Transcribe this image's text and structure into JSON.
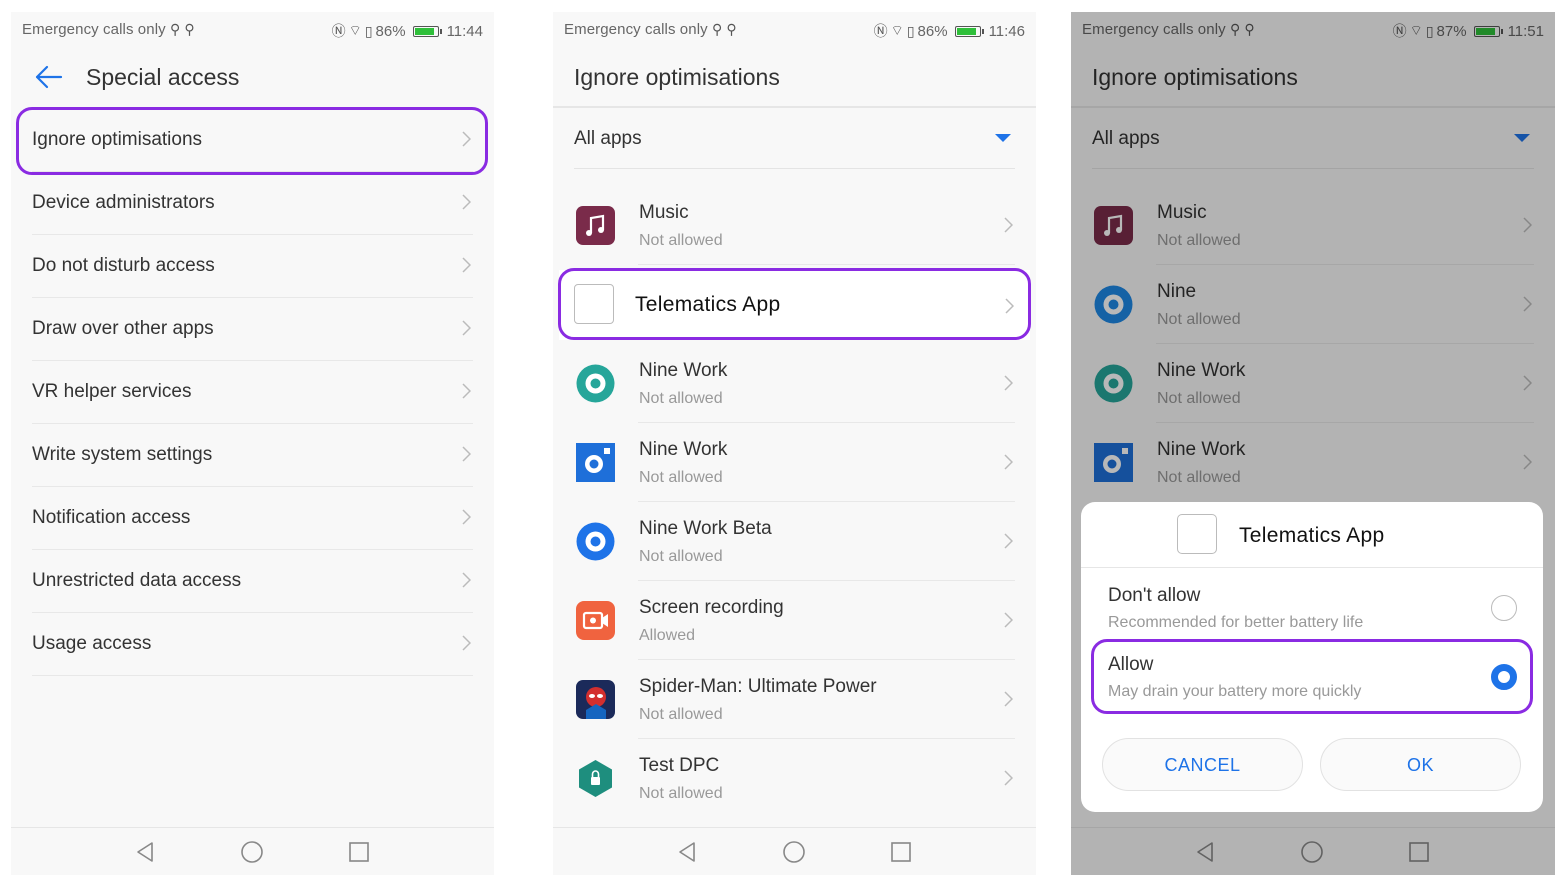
{
  "status_bar": {
    "left_text": "Emergency calls only",
    "screens": [
      {
        "battery": "86%",
        "time": "11:44"
      },
      {
        "battery": "86%",
        "time": "11:46"
      },
      {
        "battery": "87%",
        "time": "11:51"
      }
    ]
  },
  "screen1": {
    "title": "Special access",
    "items": [
      {
        "label": "Ignore optimisations"
      },
      {
        "label": "Device administrators"
      },
      {
        "label": "Do not disturb access"
      },
      {
        "label": "Draw over other apps"
      },
      {
        "label": "VR helper services"
      },
      {
        "label": "Write system settings"
      },
      {
        "label": "Notification access"
      },
      {
        "label": "Unrestricted data access"
      },
      {
        "label": "Usage access"
      }
    ]
  },
  "screen2": {
    "title": "Ignore optimisations",
    "filter": "All apps",
    "highlighted_app": "Telematics App",
    "apps": [
      {
        "name": "Music",
        "status": "Not allowed",
        "icon": "music-icon"
      },
      {
        "name": "Nine Work",
        "status": "Not allowed",
        "icon": "nine-work-green-icon"
      },
      {
        "name": "Nine Work",
        "status": "Not allowed",
        "icon": "nine-work-square-icon"
      },
      {
        "name": "Nine Work Beta",
        "status": "Not allowed",
        "icon": "nine-work-beta-icon"
      },
      {
        "name": "Screen recording",
        "status": "Allowed",
        "icon": "screen-recording-icon"
      },
      {
        "name": "Spider-Man: Ultimate Power",
        "status": "Not allowed",
        "icon": "spiderman-icon"
      },
      {
        "name": "Test DPC",
        "status": "Not allowed",
        "icon": "test-dpc-icon"
      }
    ]
  },
  "screen3": {
    "title": "Ignore optimisations",
    "filter": "All apps",
    "apps": [
      {
        "name": "Music",
        "status": "Not allowed",
        "icon": "music-icon"
      },
      {
        "name": "Nine",
        "status": "Not allowed",
        "icon": "nine-icon"
      },
      {
        "name": "Nine Work",
        "status": "Not allowed",
        "icon": "nine-work-green-icon"
      },
      {
        "name": "Nine Work",
        "status": "Not allowed",
        "icon": "nine-work-square-icon"
      }
    ],
    "dialog": {
      "app_name": "Telematics App",
      "options": [
        {
          "title": "Don't allow",
          "subtitle": "Recommended for better battery life",
          "selected": false
        },
        {
          "title": "Allow",
          "subtitle": "May drain your battery more quickly",
          "selected": true
        }
      ],
      "cancel_label": "CANCEL",
      "ok_label": "OK"
    }
  },
  "colors": {
    "accent": "#1e73e8",
    "highlight": "#8a2be2",
    "battery": "#2fbf3a"
  }
}
